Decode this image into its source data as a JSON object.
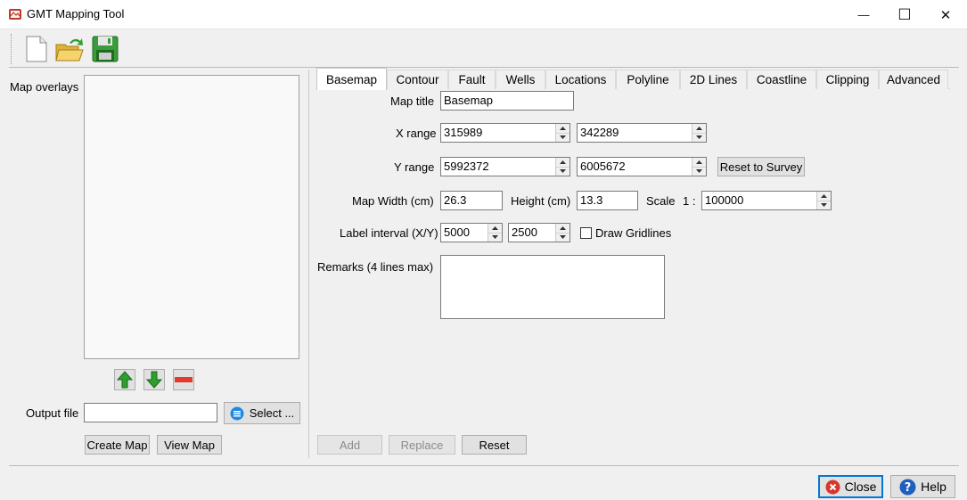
{
  "window": {
    "title": "GMT Mapping Tool",
    "minimize_glyph": "—",
    "maximize_glyph": "☐",
    "close_glyph": "✕"
  },
  "toolbar": {
    "icons": [
      "new-file-icon",
      "open-folder-icon",
      "save-disk-icon"
    ]
  },
  "left": {
    "map_overlays_label": "Map overlays",
    "overlay_items": [],
    "output_file_label": "Output file",
    "output_file_value": "",
    "select_label": "Select ...",
    "create_map_label": "Create Map",
    "view_map_label": "View Map"
  },
  "tabs": [
    {
      "label": "Basemap",
      "active": true
    },
    {
      "label": "Contour"
    },
    {
      "label": "Fault"
    },
    {
      "label": "Wells"
    },
    {
      "label": "Locations"
    },
    {
      "label": "Polyline"
    },
    {
      "label": "2D Lines"
    },
    {
      "label": "Coastline"
    },
    {
      "label": "Clipping"
    },
    {
      "label": "Advanced"
    }
  ],
  "basemap": {
    "map_title_label": "Map title",
    "map_title_value": "Basemap",
    "x_range_label": "X range",
    "x_min": "315989",
    "x_max": "342289",
    "y_range_label": "Y range",
    "y_min": "5992372",
    "y_max": "6005672",
    "reset_to_survey_label": "Reset to Survey",
    "map_width_label": "Map Width (cm)",
    "map_width_value": "26.3",
    "height_label": "Height (cm)",
    "height_value": "13.3",
    "scale_label": "Scale",
    "scale_prefix": "1 :",
    "scale_value": "100000",
    "label_interval_label": "Label interval (X/Y)",
    "label_interval_x": "5000",
    "label_interval_y": "2500",
    "draw_gridlines_label": "Draw Gridlines",
    "draw_gridlines_checked": false,
    "remarks_label": "Remarks (4 lines max)",
    "remarks_value": ""
  },
  "actions": {
    "add_label": "Add",
    "replace_label": "Replace",
    "reset_label": "Reset"
  },
  "footer": {
    "close_label": "Close",
    "help_label": "Help"
  },
  "colors": {
    "accent": "#0078d7",
    "arrow_green": "#2e9e2e",
    "remove_red": "#e23b2e",
    "close_red": "#d9352b",
    "help_blue": "#1f5fbf"
  }
}
